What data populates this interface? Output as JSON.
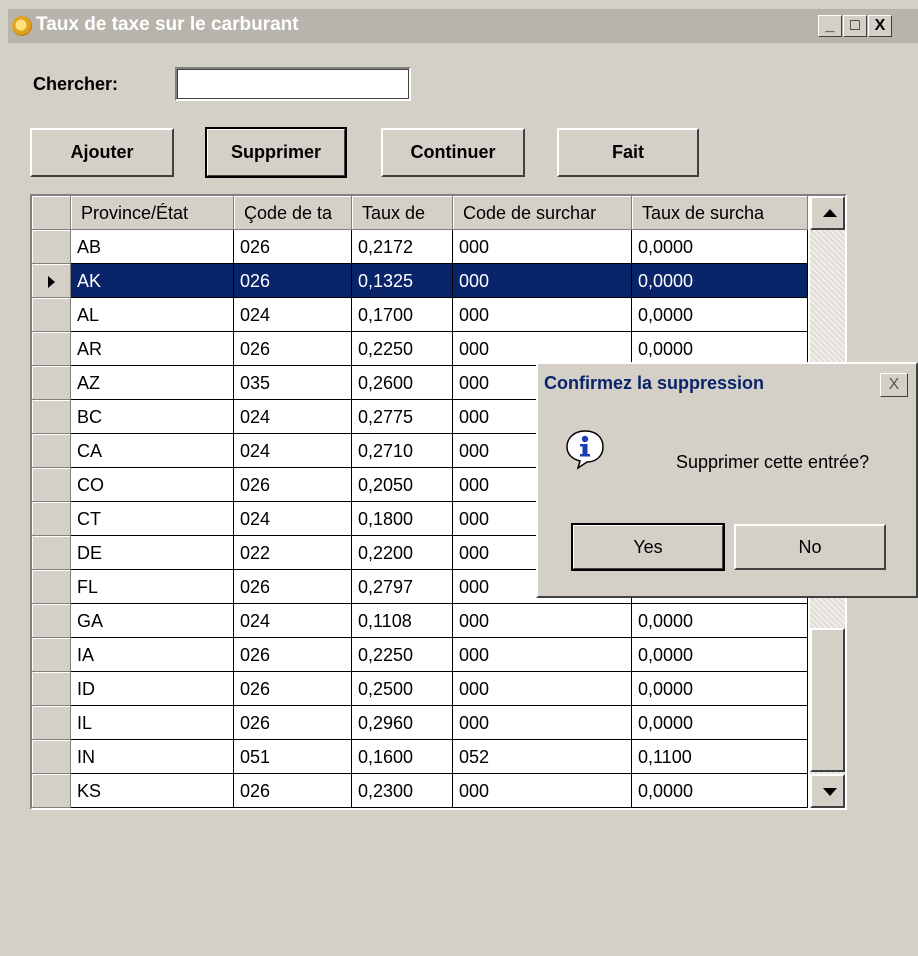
{
  "window": {
    "title": "Taux de taxe sur le carburant",
    "controls": [
      "_",
      "□",
      "X"
    ]
  },
  "search": {
    "label": "Chercher:",
    "value": "",
    "placeholder": ""
  },
  "toolbar": {
    "add_label": "Ajouter",
    "delete_label": "Supprimer",
    "continue_label": "Continuer",
    "done_label": "Fait"
  },
  "grid": {
    "columns": [
      "Province/État",
      "Çode de ta",
      "Taux de",
      "Code de surchar",
      "Taux de surcha"
    ],
    "rows": [
      [
        "AB",
        "026",
        "0,2172",
        "000",
        "0,0000"
      ],
      [
        "AK",
        "026",
        "0,1325",
        "000",
        "0,0000"
      ],
      [
        "AL",
        "024",
        "0,1700",
        "000",
        "0,0000"
      ],
      [
        "AR",
        "026",
        "0,2250",
        "000",
        "0,0000"
      ],
      [
        "AZ",
        "035",
        "0,2600",
        "000",
        ""
      ],
      [
        "BC",
        "024",
        "0,2775",
        "000",
        ""
      ],
      [
        "CA",
        "024",
        "0,2710",
        "000",
        ""
      ],
      [
        "CO",
        "026",
        "0,2050",
        "000",
        ""
      ],
      [
        "CT",
        "024",
        "0,1800",
        "000",
        ""
      ],
      [
        "DE",
        "022",
        "0,2200",
        "000",
        ""
      ],
      [
        "FL",
        "026",
        "0,2797",
        "000",
        "0,0000"
      ],
      [
        "GA",
        "024",
        "0,1108",
        "000",
        "0,0000"
      ],
      [
        "IA",
        "026",
        "0,2250",
        "000",
        "0,0000"
      ],
      [
        "ID",
        "026",
        "0,2500",
        "000",
        "0,0000"
      ],
      [
        "IL",
        "026",
        "0,2960",
        "000",
        "0,0000"
      ],
      [
        "IN",
        "051",
        "0,1600",
        "052",
        "0,1100"
      ],
      [
        "KS",
        "026",
        "0,2300",
        "000",
        "0,0000"
      ]
    ],
    "selected_row": 1
  },
  "dialog": {
    "title": "Confirmez la suppression",
    "close": "X",
    "message": "Supprimer cette entrée?",
    "yes_label": "Yes",
    "no_label": "No"
  },
  "colors": {
    "selection": "#0a246a",
    "dialog_title": "#0a246a",
    "window_bg": "#d4d0c8"
  },
  "icons": [
    "app-gear-icon",
    "minimize-icon",
    "maximize-icon",
    "close-icon",
    "info-icon",
    "scroll-up-icon",
    "scroll-down-icon",
    "row-pointer-icon"
  ]
}
